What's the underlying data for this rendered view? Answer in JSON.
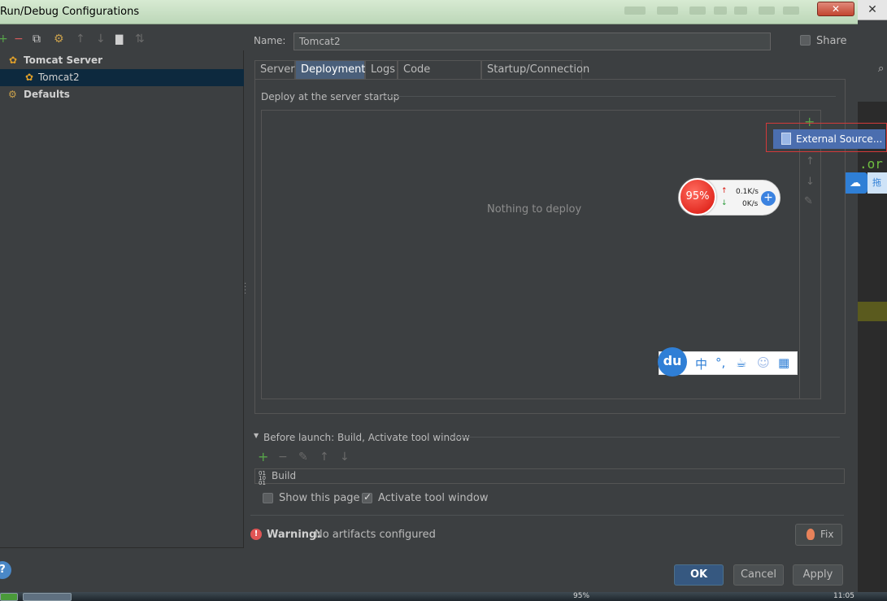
{
  "window": {
    "title": "Run/Debug Configurations",
    "close_label": "✕"
  },
  "left_toolbar": {
    "add_icon": "+",
    "remove_icon": "−",
    "copy_icon": "⧉",
    "edit_defaults_icon": "⚙",
    "move_up_icon": "↑",
    "move_down_icon": "↓",
    "folder_icon": "▇",
    "sort_icon": "⇅"
  },
  "tree": {
    "items": [
      {
        "label": "Tomcat Server",
        "icon": "tomcat-icon"
      },
      {
        "label": "Tomcat2",
        "icon": "tomcat-icon"
      },
      {
        "label": "Defaults",
        "icon": "wrench-icon"
      }
    ]
  },
  "form": {
    "name_label": "Name:",
    "name_value": "Tomcat2",
    "share_label": "Share",
    "share_checked": false
  },
  "tabs": [
    "Server",
    "Deployment",
    "Logs",
    "Code Coverage",
    "Startup/Connection"
  ],
  "active_tab": "Deployment",
  "deployment": {
    "section_title": "Deploy at the server startup",
    "empty_text": "Nothing to deploy",
    "side_add_icon": "+",
    "side_up_icon": "↑",
    "side_down_icon": "↓",
    "side_edit_icon": "✎",
    "popup_item": "External Source..."
  },
  "net_widget": {
    "percent": "95%",
    "up_speed": "0.1K/s",
    "down_speed": "0K/s",
    "up_arrow": "↑",
    "down_arrow": "↓",
    "plus": "+"
  },
  "ime_bar": {
    "logo": "du",
    "icons": [
      "中",
      "°,",
      "☕",
      "☺",
      "▦"
    ]
  },
  "before_launch": {
    "title": "Before launch: Build, Activate tool window",
    "add_icon": "+",
    "remove_icon": "−",
    "edit_icon": "✎",
    "up_icon": "↑",
    "down_icon": "↓",
    "tasks": [
      "Build"
    ],
    "show_page_label": "Show this page",
    "show_page_checked": false,
    "activate_label": "Activate tool window",
    "activate_checked": true
  },
  "warning": {
    "prefix": "Warning:",
    "text": "No artifacts configured",
    "fix_label": "Fix"
  },
  "buttons": {
    "ok": "OK",
    "cancel": "Cancel",
    "apply": "Apply"
  },
  "help_label": "?",
  "right_strip": {
    "close_label": "✕",
    "code_text": ".or",
    "cloud_text": "拖"
  },
  "taskbar": {
    "percent": "95%",
    "time": "11:05"
  }
}
